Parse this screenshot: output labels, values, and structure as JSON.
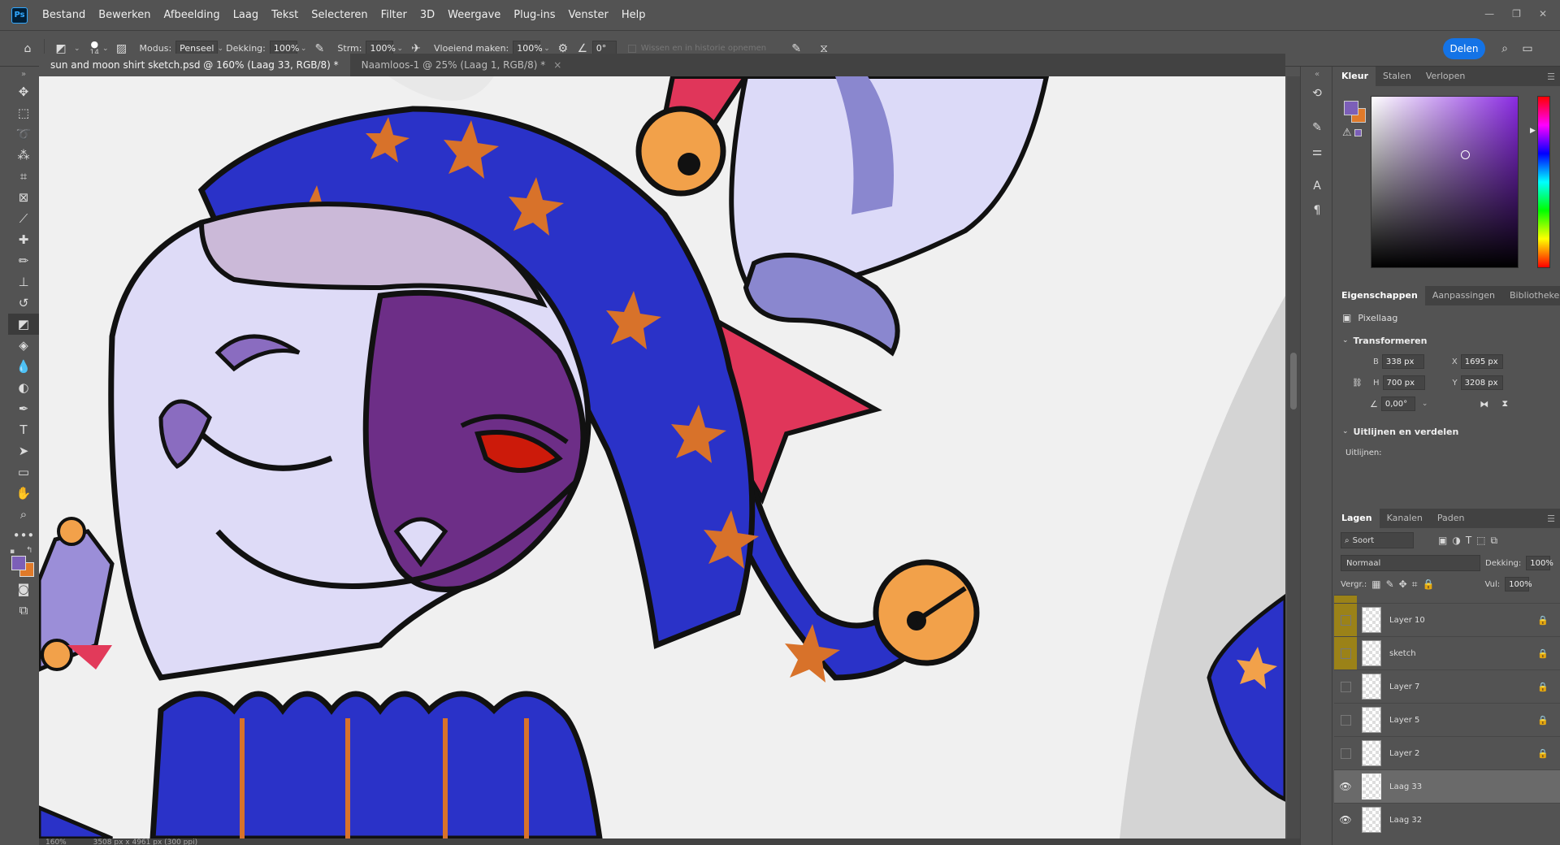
{
  "menu": [
    "Bestand",
    "Bewerken",
    "Afbeelding",
    "Laag",
    "Tekst",
    "Selecteren",
    "Filter",
    "3D",
    "Weergave",
    "Plug-ins",
    "Venster",
    "Help"
  ],
  "options": {
    "brush_size": "14",
    "modus_label": "Modus:",
    "modus_value": "Penseel",
    "dekking_label": "Dekking:",
    "dekking_value": "100%",
    "stroom_label": "Strm:",
    "stroom_value": "100%",
    "vloeiend_label": "Vloeiend maken:",
    "vloeiend_value": "100%",
    "angle_value": "0°",
    "history_label": "Wissen en in historie opnemen",
    "share_label": "Delen"
  },
  "tabs": [
    {
      "label": "sun and moon shirt sketch.psd @ 160% (Laag 33, RGB/8) *",
      "active": true
    },
    {
      "label": "Naamloos-1 @ 25% (Laag 1, RGB/8) *",
      "active": false
    }
  ],
  "status": {
    "zoom": "160%",
    "dims": "3508 px x 4961 px (300 ppi)"
  },
  "color_panel": {
    "tabs": [
      "Kleur",
      "Stalen",
      "Verlopen"
    ],
    "fg": "#7c5fb8",
    "bg": "#e07a2a"
  },
  "properties": {
    "tabs": [
      "Eigenschappen",
      "Aanpassingen",
      "Bibliotheken"
    ],
    "type": "Pixellaag",
    "transform_title": "Transformeren",
    "w_label": "B",
    "w_value": "338 px",
    "h_label": "H",
    "h_value": "700 px",
    "x_label": "X",
    "x_value": "1695 px",
    "y_label": "Y",
    "y_value": "3208 px",
    "angle": "0,00°",
    "align_title": "Uitlijnen en verdelen",
    "align_label": "Uitlijnen:"
  },
  "layers_panel": {
    "tabs": [
      "Lagen",
      "Kanalen",
      "Paden"
    ],
    "kind": "Soort",
    "blend": "Normaal",
    "opacity_label": "Dekking:",
    "opacity": "100%",
    "lock_label": "Vergr.:",
    "fill_label": "Vul:",
    "fill": "100%",
    "layers": [
      {
        "name": "Layer 10",
        "visible": false,
        "gold": true,
        "locked": true
      },
      {
        "name": "sketch",
        "visible": false,
        "gold": true,
        "locked": true
      },
      {
        "name": "Layer 7",
        "visible": false,
        "gold": false,
        "locked": true
      },
      {
        "name": "Layer 5",
        "visible": false,
        "gold": false,
        "locked": true
      },
      {
        "name": "Layer 2",
        "visible": false,
        "gold": false,
        "locked": true
      },
      {
        "name": "Laag 33",
        "visible": true,
        "gold": false,
        "locked": false,
        "selected": true
      },
      {
        "name": "Laag 32",
        "visible": true,
        "gold": false,
        "locked": false
      }
    ]
  }
}
